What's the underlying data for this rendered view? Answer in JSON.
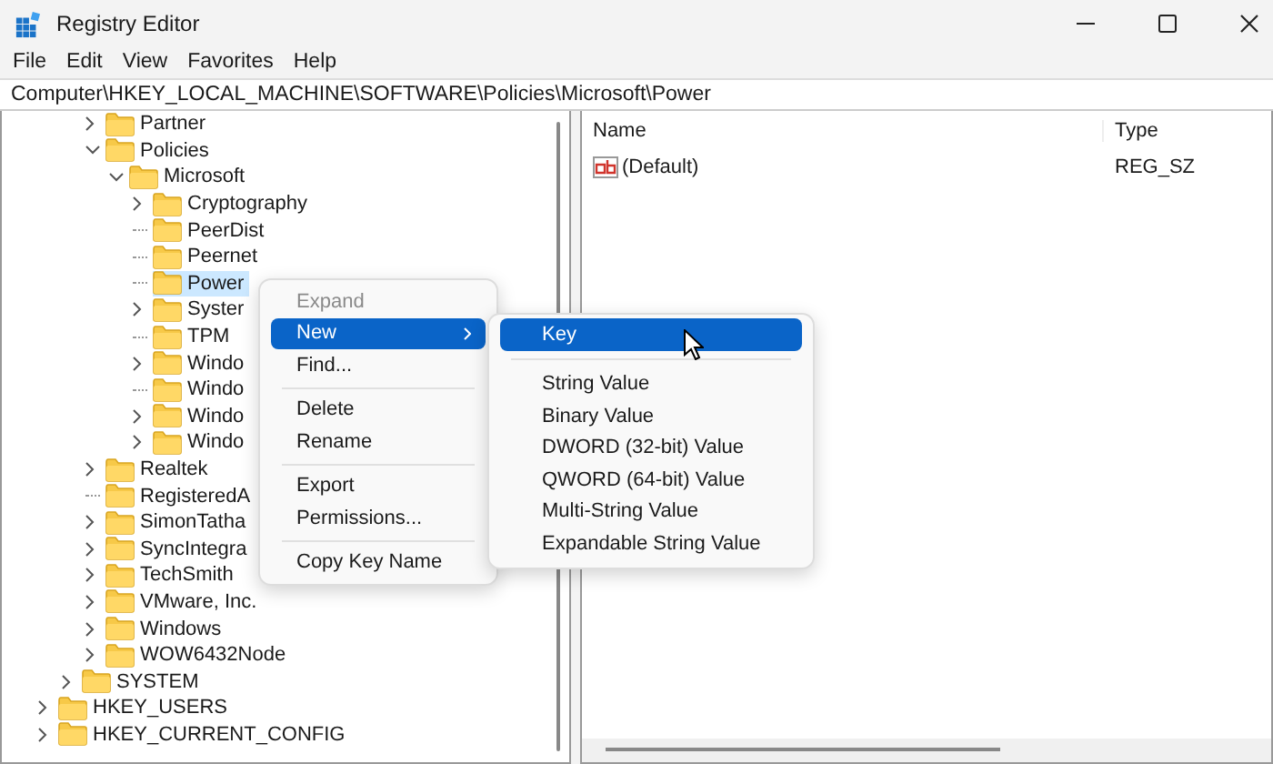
{
  "window": {
    "title": "Registry Editor"
  },
  "menu_bar": [
    "File",
    "Edit",
    "View",
    "Favorites",
    "Help"
  ],
  "address_bar": {
    "value": "Computer\\HKEY_LOCAL_MACHINE\\SOFTWARE\\Policies\\Microsoft\\Power"
  },
  "tree": {
    "items": [
      {
        "children": [
          {
            "children": [
              {
                "label": "Partner",
                "kind": "branch",
                "expanded": false,
                "selected": false
              },
              {
                "label": "Policies",
                "kind": "branch",
                "expanded": true,
                "selected": false,
                "children": [
                  {
                    "label": "Microsoft",
                    "kind": "branch",
                    "expanded": true,
                    "selected": false,
                    "children": [
                      {
                        "label": "Cryptography",
                        "kind": "branch",
                        "expanded": false,
                        "selected": false
                      },
                      {
                        "label": "PeerDist",
                        "kind": "leaf",
                        "selected": false
                      },
                      {
                        "label": "Peernet",
                        "kind": "leaf",
                        "selected": false
                      },
                      {
                        "label": "Power",
                        "kind": "leaf",
                        "selected": true
                      },
                      {
                        "label": "Syster",
                        "kind": "branch",
                        "expanded": false,
                        "selected": false
                      },
                      {
                        "label": "TPM",
                        "kind": "leaf",
                        "selected": false
                      },
                      {
                        "label": "Windo",
                        "kind": "branch",
                        "expanded": false,
                        "selected": false
                      },
                      {
                        "label": "Windo",
                        "kind": "leaf",
                        "selected": false
                      },
                      {
                        "label": "Windo",
                        "kind": "branch",
                        "expanded": false,
                        "selected": false
                      },
                      {
                        "label": "Windo",
                        "kind": "branch",
                        "expanded": false,
                        "selected": false
                      }
                    ]
                  }
                ]
              },
              {
                "label": "Realtek",
                "kind": "branch",
                "expanded": false,
                "selected": false
              },
              {
                "label": "RegisteredA",
                "kind": "leaf",
                "selected": false
              },
              {
                "label": "SimonTatha",
                "kind": "branch",
                "expanded": false,
                "selected": false
              },
              {
                "label": "SyncIntegra",
                "kind": "branch",
                "expanded": false,
                "selected": false
              },
              {
                "label": "TechSmith",
                "kind": "branch",
                "expanded": false,
                "selected": false
              },
              {
                "label": "VMware, Inc.",
                "kind": "branch",
                "expanded": false,
                "selected": false
              },
              {
                "label": "Windows",
                "kind": "branch",
                "expanded": false,
                "selected": false
              },
              {
                "label": "WOW6432Node",
                "kind": "branch",
                "expanded": false,
                "selected": false
              }
            ]
          },
          {
            "label": "SYSTEM",
            "kind": "branch",
            "expanded": false,
            "selected": false
          }
        ]
      },
      {
        "label": "HKEY_USERS",
        "kind": "branch",
        "expanded": false,
        "selected": false
      },
      {
        "label": "HKEY_CURRENT_CONFIG",
        "kind": "branch",
        "expanded": false,
        "selected": false
      }
    ]
  },
  "values_table": {
    "columns": [
      "Name",
      "Type"
    ],
    "rows": [
      {
        "name": "(Default)",
        "type": "REG_SZ"
      }
    ]
  },
  "context_menu": {
    "items": [
      {
        "kind": "item",
        "label": "Expand",
        "disabled": true,
        "selected": false,
        "submenu": false
      },
      {
        "kind": "item",
        "label": "New",
        "disabled": false,
        "selected": true,
        "submenu": true
      },
      {
        "kind": "item",
        "label": "Find...",
        "disabled": false,
        "selected": false,
        "submenu": false
      },
      {
        "kind": "separator"
      },
      {
        "kind": "item",
        "label": "Delete",
        "disabled": false,
        "selected": false,
        "submenu": false
      },
      {
        "kind": "item",
        "label": "Rename",
        "disabled": false,
        "selected": false,
        "submenu": false
      },
      {
        "kind": "separator"
      },
      {
        "kind": "item",
        "label": "Export",
        "disabled": false,
        "selected": false,
        "submenu": false
      },
      {
        "kind": "item",
        "label": "Permissions...",
        "disabled": false,
        "selected": false,
        "submenu": false
      },
      {
        "kind": "separator"
      },
      {
        "kind": "item",
        "label": "Copy Key Name",
        "disabled": false,
        "selected": false,
        "submenu": false
      }
    ]
  },
  "submenu": {
    "items": [
      {
        "kind": "item",
        "label": "Key",
        "disabled": false,
        "selected": true,
        "submenu": false
      },
      {
        "kind": "separator"
      },
      {
        "kind": "item",
        "label": "String Value",
        "disabled": false,
        "selected": false,
        "submenu": false
      },
      {
        "kind": "item",
        "label": "Binary Value",
        "disabled": false,
        "selected": false,
        "submenu": false
      },
      {
        "kind": "item",
        "label": "DWORD (32-bit) Value",
        "disabled": false,
        "selected": false,
        "submenu": false
      },
      {
        "kind": "item",
        "label": "QWORD (64-bit) Value",
        "disabled": false,
        "selected": false,
        "submenu": false
      },
      {
        "kind": "item",
        "label": "Multi-String Value",
        "disabled": false,
        "selected": false,
        "submenu": false
      },
      {
        "kind": "item",
        "label": "Expandable String Value",
        "disabled": false,
        "selected": false,
        "submenu": false
      }
    ]
  }
}
